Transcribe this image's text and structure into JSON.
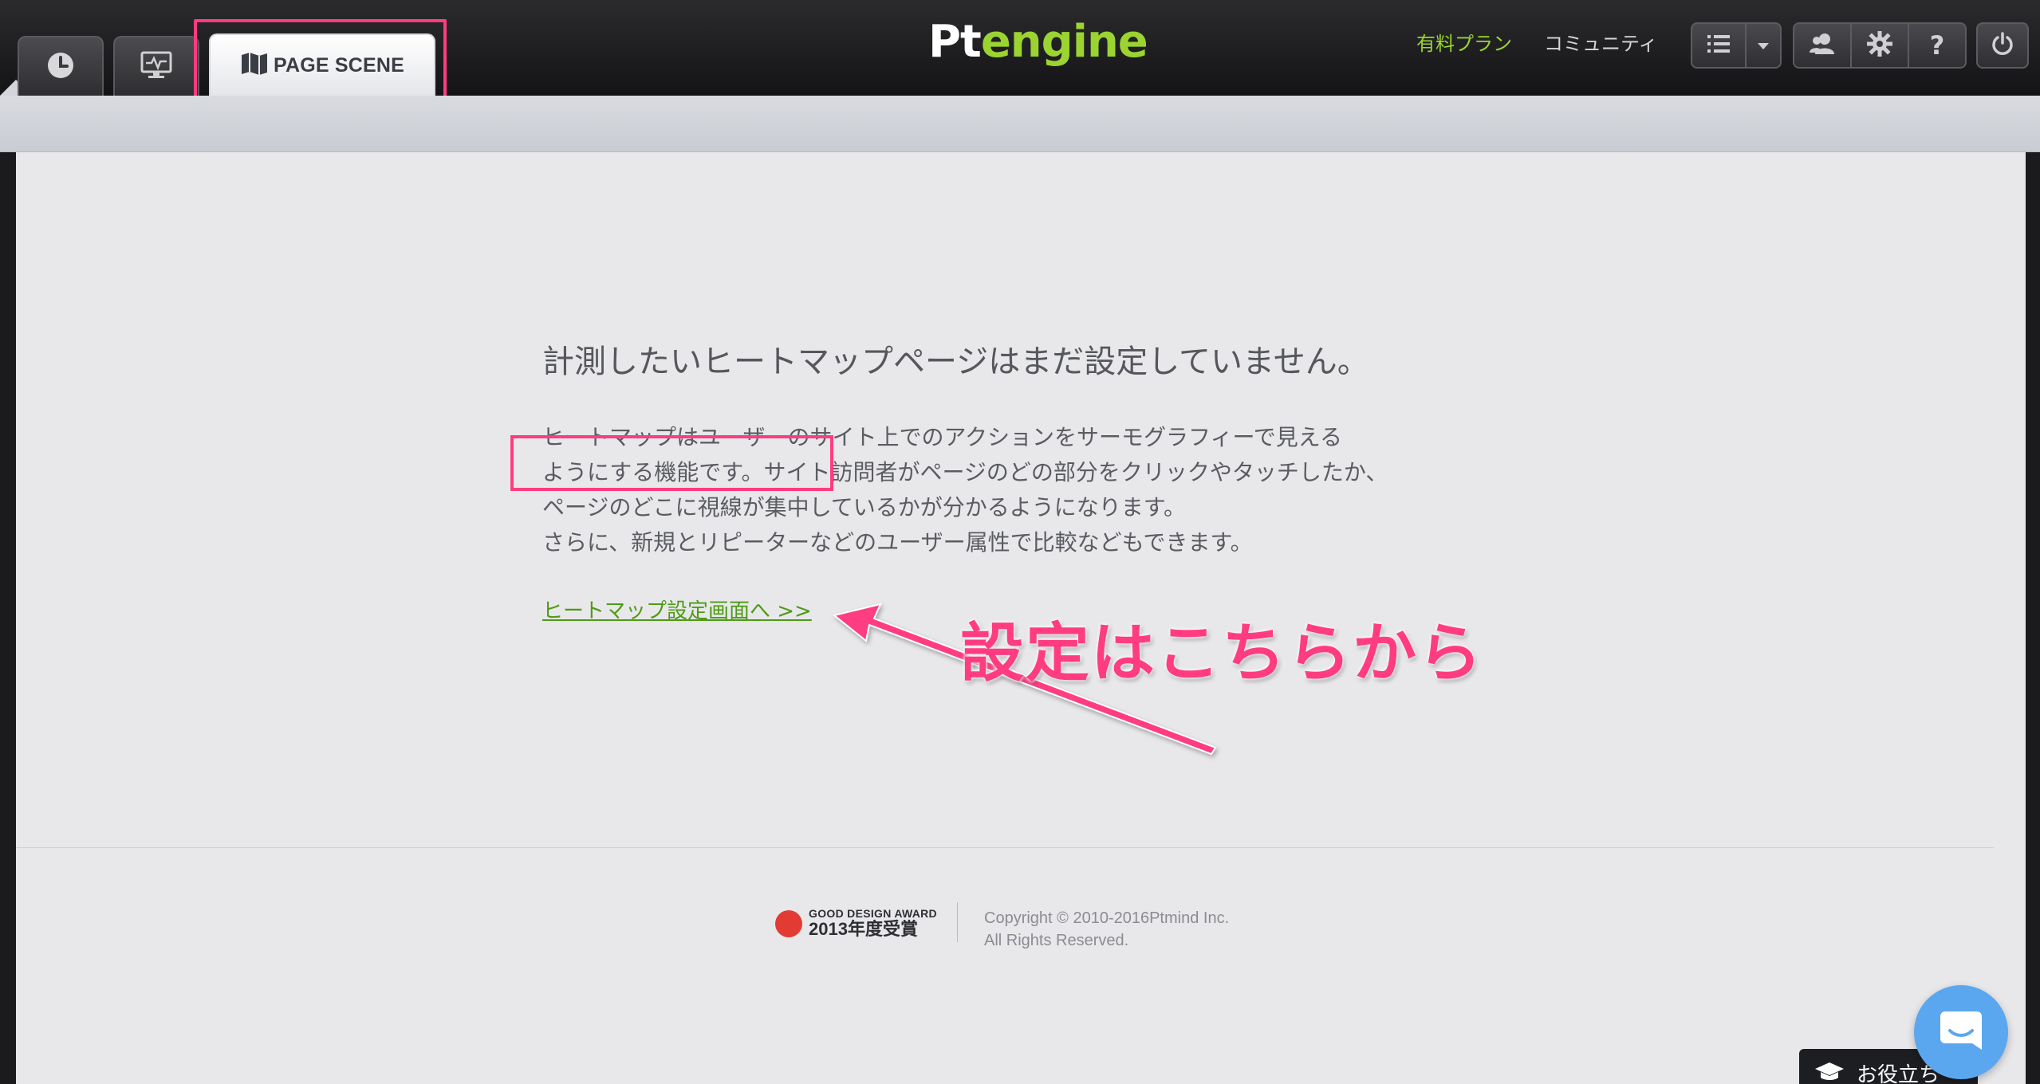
{
  "header": {
    "tabs": [
      {
        "name": "clock-tab",
        "icon": "clock-icon"
      },
      {
        "name": "monitor-tab",
        "icon": "monitor-icon"
      },
      {
        "name": "page-scene-tab",
        "icon": "map-icon",
        "label": "PAGE SCENE",
        "active": true
      }
    ],
    "logo": {
      "part1": "Pt",
      "part2": "engine"
    },
    "nav": {
      "paid_plan": "有料プラン",
      "community": "コミュニティ"
    },
    "icon_buttons": [
      "list-icon",
      "chevron-down-icon",
      "user-icon",
      "gear-icon",
      "help-icon",
      "power-icon"
    ],
    "help_glyph": "?"
  },
  "main": {
    "title": "計測したいヒートマップページはまだ設定していません。",
    "paragraph": [
      "ヒートマップはユーザーのサイト上でのアクションをサーモグラフィーで見える",
      "ようにする機能です。サイト訪問者がページのどの部分をクリックやタッチしたか、",
      "ページのどこに視線が集中しているかが分かるようになります。",
      "さらに、新規とリピーターなどのユーザー属性で比較などもできます。"
    ],
    "link": "ヒートマップ設定画面へ >>"
  },
  "annotation": {
    "text": "設定はこちらから",
    "color": "#ff3c80"
  },
  "footer": {
    "award_line1": "GOOD DESIGN AWARD",
    "award_line2": "2013年度受賞",
    "copyright_line1": "Copyright © 2010-2016Ptmind Inc.",
    "copyright_line2": "All Rights Reserved."
  },
  "help_tab": {
    "label": "お役立ち",
    "icon": "graduation-cap-icon"
  },
  "chat": {
    "icon": "chat-icon",
    "color": "#5aa7ef"
  },
  "colors": {
    "accent_green": "#9bd431",
    "link_green": "#4e9b14",
    "highlight_pink": "#ff3c80"
  }
}
